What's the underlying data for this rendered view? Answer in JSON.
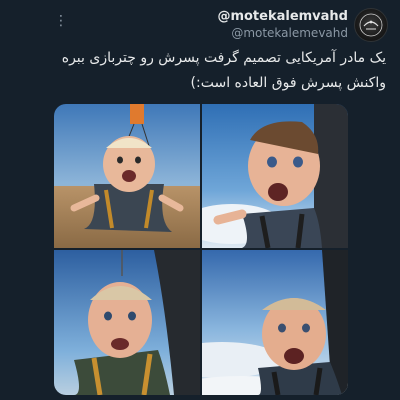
{
  "tweet": {
    "display_name": "@motekalemvahd",
    "handle": "@motekalemevahd",
    "text": "یک مادر آمریکایی تصمیم گرفت پسرش رو چتربازی ببره واکنش پسرش فوق العاده است:)"
  },
  "menu": {
    "icon": "more-vertical-icon",
    "glyph": "⋮"
  },
  "media": {
    "count": 4,
    "images": [
      {
        "name": "baby-skydiving-photo-1"
      },
      {
        "name": "baby-skydiving-photo-2"
      },
      {
        "name": "baby-skydiving-photo-3"
      },
      {
        "name": "baby-skydiving-photo-4"
      }
    ]
  }
}
